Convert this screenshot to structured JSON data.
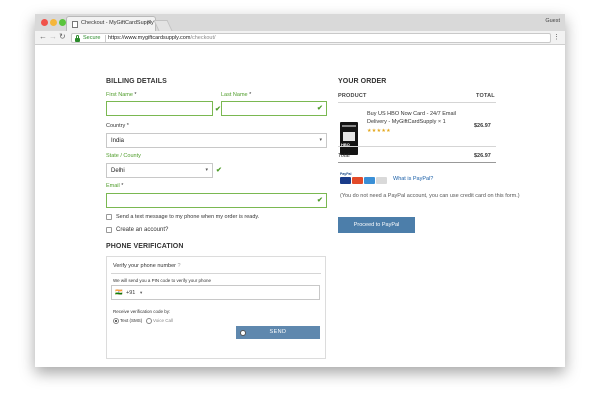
{
  "browser": {
    "tab_title": "Checkout - MyGiftCardSupply",
    "tab_close": "×",
    "profile": "Guest",
    "secure_label": "Secure",
    "url_host": "https://www.mygiftcardsupply.com",
    "url_path": "/checkout/",
    "back": "←",
    "forward": "→",
    "reload": "↻",
    "menu": "⋮"
  },
  "billing": {
    "heading": "BILLING DETAILS",
    "first_name_label": "First Name",
    "last_name_label": "Last Name",
    "required_mark": "*",
    "country_label": "Country",
    "country_value": "India",
    "state_label": "State / County",
    "state_value": "Delhi",
    "email_label": "Email",
    "check_mark": "✔",
    "caret": "▾",
    "sms_opt_in": "Send a text message to my phone when my order is ready.",
    "create_account": "Create an account?"
  },
  "phone_verification": {
    "heading": "PHONE VERIFICATION",
    "verify_label": "Verify your phone number",
    "help_mark": "?",
    "send_pin_text": "We will send you a PIN code to verify your phone",
    "flag": "🇮🇳",
    "dial_code": "+91",
    "receive_label": "Receive verification code by:",
    "option_sms": "Text (SMS)",
    "option_voice": "Voice Call",
    "send_button": "SEND"
  },
  "order": {
    "heading": "YOUR ORDER",
    "col_product": "PRODUCT",
    "col_total": "TOTAL",
    "product_name": "Buy US HBO Now Card - 24/7 Email Delivery - MyGiftCardSupply × 1",
    "card_logo_text": "HBO",
    "stars": "★★★★★",
    "product_price": "$26.97",
    "total_label": "Total",
    "total_value": "$26.97",
    "paypal_mini": "PayPal",
    "what_is_paypal": "What is PayPal?",
    "paypal_note": "(You do not need a PayPal account, you can use credit card on this form.)",
    "proceed_button": "Proceed to PayPal"
  },
  "colors": {
    "accent_green": "#4f9d2a",
    "button_blue": "#4c7eaa",
    "send_blue": "#5f88ae"
  }
}
